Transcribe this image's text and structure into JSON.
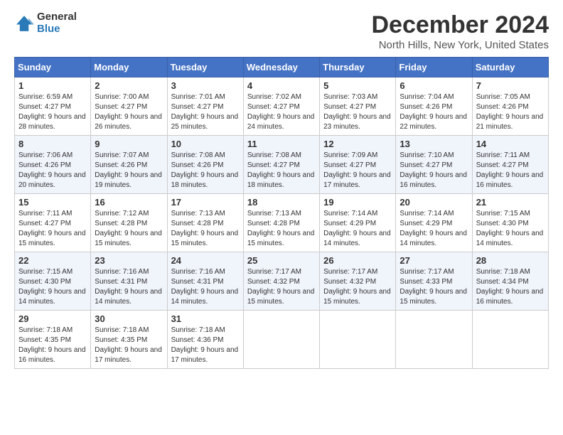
{
  "logo": {
    "general": "General",
    "blue": "Blue"
  },
  "title": "December 2024",
  "subtitle": "North Hills, New York, United States",
  "days_header": [
    "Sunday",
    "Monday",
    "Tuesday",
    "Wednesday",
    "Thursday",
    "Friday",
    "Saturday"
  ],
  "weeks": [
    [
      {
        "day": "1",
        "sunrise": "6:59 AM",
        "sunset": "4:27 PM",
        "daylight": "9 hours and 28 minutes."
      },
      {
        "day": "2",
        "sunrise": "7:00 AM",
        "sunset": "4:27 PM",
        "daylight": "9 hours and 26 minutes."
      },
      {
        "day": "3",
        "sunrise": "7:01 AM",
        "sunset": "4:27 PM",
        "daylight": "9 hours and 25 minutes."
      },
      {
        "day": "4",
        "sunrise": "7:02 AM",
        "sunset": "4:27 PM",
        "daylight": "9 hours and 24 minutes."
      },
      {
        "day": "5",
        "sunrise": "7:03 AM",
        "sunset": "4:27 PM",
        "daylight": "9 hours and 23 minutes."
      },
      {
        "day": "6",
        "sunrise": "7:04 AM",
        "sunset": "4:26 PM",
        "daylight": "9 hours and 22 minutes."
      },
      {
        "day": "7",
        "sunrise": "7:05 AM",
        "sunset": "4:26 PM",
        "daylight": "9 hours and 21 minutes."
      }
    ],
    [
      {
        "day": "8",
        "sunrise": "7:06 AM",
        "sunset": "4:26 PM",
        "daylight": "9 hours and 20 minutes."
      },
      {
        "day": "9",
        "sunrise": "7:07 AM",
        "sunset": "4:26 PM",
        "daylight": "9 hours and 19 minutes."
      },
      {
        "day": "10",
        "sunrise": "7:08 AM",
        "sunset": "4:26 PM",
        "daylight": "9 hours and 18 minutes."
      },
      {
        "day": "11",
        "sunrise": "7:08 AM",
        "sunset": "4:27 PM",
        "daylight": "9 hours and 18 minutes."
      },
      {
        "day": "12",
        "sunrise": "7:09 AM",
        "sunset": "4:27 PM",
        "daylight": "9 hours and 17 minutes."
      },
      {
        "day": "13",
        "sunrise": "7:10 AM",
        "sunset": "4:27 PM",
        "daylight": "9 hours and 16 minutes."
      },
      {
        "day": "14",
        "sunrise": "7:11 AM",
        "sunset": "4:27 PM",
        "daylight": "9 hours and 16 minutes."
      }
    ],
    [
      {
        "day": "15",
        "sunrise": "7:11 AM",
        "sunset": "4:27 PM",
        "daylight": "9 hours and 15 minutes."
      },
      {
        "day": "16",
        "sunrise": "7:12 AM",
        "sunset": "4:28 PM",
        "daylight": "9 hours and 15 minutes."
      },
      {
        "day": "17",
        "sunrise": "7:13 AM",
        "sunset": "4:28 PM",
        "daylight": "9 hours and 15 minutes."
      },
      {
        "day": "18",
        "sunrise": "7:13 AM",
        "sunset": "4:28 PM",
        "daylight": "9 hours and 15 minutes."
      },
      {
        "day": "19",
        "sunrise": "7:14 AM",
        "sunset": "4:29 PM",
        "daylight": "9 hours and 14 minutes."
      },
      {
        "day": "20",
        "sunrise": "7:14 AM",
        "sunset": "4:29 PM",
        "daylight": "9 hours and 14 minutes."
      },
      {
        "day": "21",
        "sunrise": "7:15 AM",
        "sunset": "4:30 PM",
        "daylight": "9 hours and 14 minutes."
      }
    ],
    [
      {
        "day": "22",
        "sunrise": "7:15 AM",
        "sunset": "4:30 PM",
        "daylight": "9 hours and 14 minutes."
      },
      {
        "day": "23",
        "sunrise": "7:16 AM",
        "sunset": "4:31 PM",
        "daylight": "9 hours and 14 minutes."
      },
      {
        "day": "24",
        "sunrise": "7:16 AM",
        "sunset": "4:31 PM",
        "daylight": "9 hours and 14 minutes."
      },
      {
        "day": "25",
        "sunrise": "7:17 AM",
        "sunset": "4:32 PM",
        "daylight": "9 hours and 15 minutes."
      },
      {
        "day": "26",
        "sunrise": "7:17 AM",
        "sunset": "4:32 PM",
        "daylight": "9 hours and 15 minutes."
      },
      {
        "day": "27",
        "sunrise": "7:17 AM",
        "sunset": "4:33 PM",
        "daylight": "9 hours and 15 minutes."
      },
      {
        "day": "28",
        "sunrise": "7:18 AM",
        "sunset": "4:34 PM",
        "daylight": "9 hours and 16 minutes."
      }
    ],
    [
      {
        "day": "29",
        "sunrise": "7:18 AM",
        "sunset": "4:35 PM",
        "daylight": "9 hours and 16 minutes."
      },
      {
        "day": "30",
        "sunrise": "7:18 AM",
        "sunset": "4:35 PM",
        "daylight": "9 hours and 17 minutes."
      },
      {
        "day": "31",
        "sunrise": "7:18 AM",
        "sunset": "4:36 PM",
        "daylight": "9 hours and 17 minutes."
      },
      null,
      null,
      null,
      null
    ]
  ]
}
